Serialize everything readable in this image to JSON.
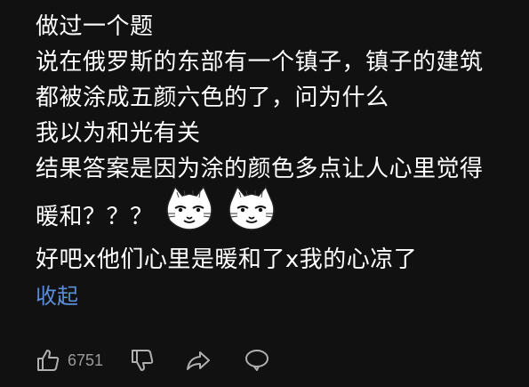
{
  "comment": {
    "lines": [
      "做过一个题",
      "说在俄罗斯的东部有一个镇子，镇子的建筑",
      "都被涂成五颜六色的了，问为什么",
      "我以为和光有关",
      "结果答案是因为涂的颜色多点让人心里觉得",
      "暖和？？？",
      "好吧x他们心里是暖和了x我的心凉了"
    ],
    "collapse_label": "收起"
  },
  "actions": {
    "like_count": "6751"
  },
  "icons": {
    "like": "thumbs-up-icon",
    "dislike": "thumbs-down-icon",
    "share": "share-arrow-icon",
    "reply": "comment-bubble-icon",
    "sticker": "cat-face-sticker"
  },
  "colors": {
    "background": "#111111",
    "text": "#ffffff",
    "link": "#5b8ed8",
    "muted": "#9a9a9a"
  }
}
